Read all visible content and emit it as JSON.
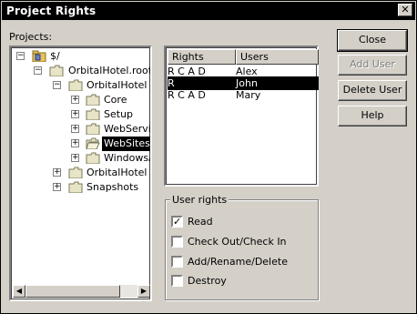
{
  "window": {
    "title": "Project Rights",
    "close_glyph": "✕"
  },
  "projects_label": "Projects:",
  "tree": {
    "nodes": [
      {
        "label": "$/"
      },
      {
        "label": "OrbitalHotel.root"
      },
      {
        "label": "OrbitalHotel"
      },
      {
        "label": "Core"
      },
      {
        "label": "Setup"
      },
      {
        "label": "WebServic"
      },
      {
        "label": "WebSites"
      },
      {
        "label": "WindowsAp"
      },
      {
        "label": "OrbitalHotel Re"
      },
      {
        "label": "Snapshots"
      }
    ]
  },
  "list": {
    "columns": [
      "Rights",
      "Users"
    ],
    "rows": [
      {
        "rights": "R C A D",
        "user": "Alex"
      },
      {
        "rights": "R",
        "user": "John"
      },
      {
        "rights": "R C A D",
        "user": "Mary"
      }
    ]
  },
  "user_rights": {
    "label": "User rights",
    "items": [
      {
        "label": "Read",
        "checked": true
      },
      {
        "label": "Check Out/Check In",
        "checked": false
      },
      {
        "label": "Add/Rename/Delete",
        "checked": false
      },
      {
        "label": "Destroy",
        "checked": false
      }
    ]
  },
  "buttons": {
    "close": "Close",
    "add_user": "Add User",
    "delete_user": "Delete User",
    "help": "Help"
  }
}
